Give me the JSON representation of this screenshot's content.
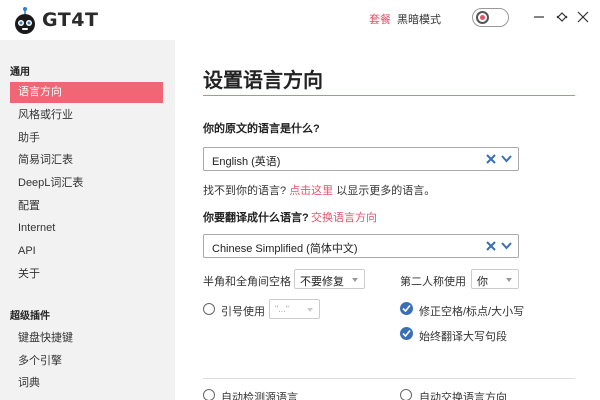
{
  "app": {
    "title": "GT4T",
    "logo_icon": "robot-logo-icon"
  },
  "titlebar": {
    "package_link": "套餐",
    "dark_mode_label": "黑暗模式",
    "dark_mode_on": false,
    "accent": "#e0556b"
  },
  "sidebar": {
    "sections": [
      {
        "title": "通用",
        "items": [
          "语言方向",
          "风格或行业",
          "助手",
          "简易词汇表",
          "DeepL词汇表",
          "配置",
          "Internet",
          "API",
          "关于"
        ]
      },
      {
        "title": "超级插件",
        "items": [
          "键盘快捷键",
          "多个引擎",
          "词典"
        ]
      }
    ],
    "active_item": "语言方向",
    "active_color": "#f06674"
  },
  "main": {
    "title": "设置语言方向",
    "source": {
      "question": "你的原文的语言是什么?",
      "value": "English (英语)",
      "hint_prefix": "找不到你的语言?",
      "hint_link": "点击这里",
      "hint_suffix": "以显示更多的语言。"
    },
    "target": {
      "question": "你要翻译成什么语言?",
      "swap_link": "交换语言方向",
      "value": "Chinese Simplified (简体中文)"
    },
    "options": {
      "space_label": "半角和全角间空格",
      "space_value": "不要修复",
      "second_person_label": "第二人称使用",
      "second_person_value": "你",
      "quote_label": "引号使用",
      "quote_value": "\"...\"",
      "fix_spacing_label": "修正空格/标点/大小写",
      "fix_spacing_checked": true,
      "translate_caps_label": "始终翻译大写句段",
      "translate_caps_checked": true
    },
    "bottom": {
      "auto_detect_label": "自动检测源语言",
      "auto_swap_label": "自动交换语言方向"
    }
  }
}
